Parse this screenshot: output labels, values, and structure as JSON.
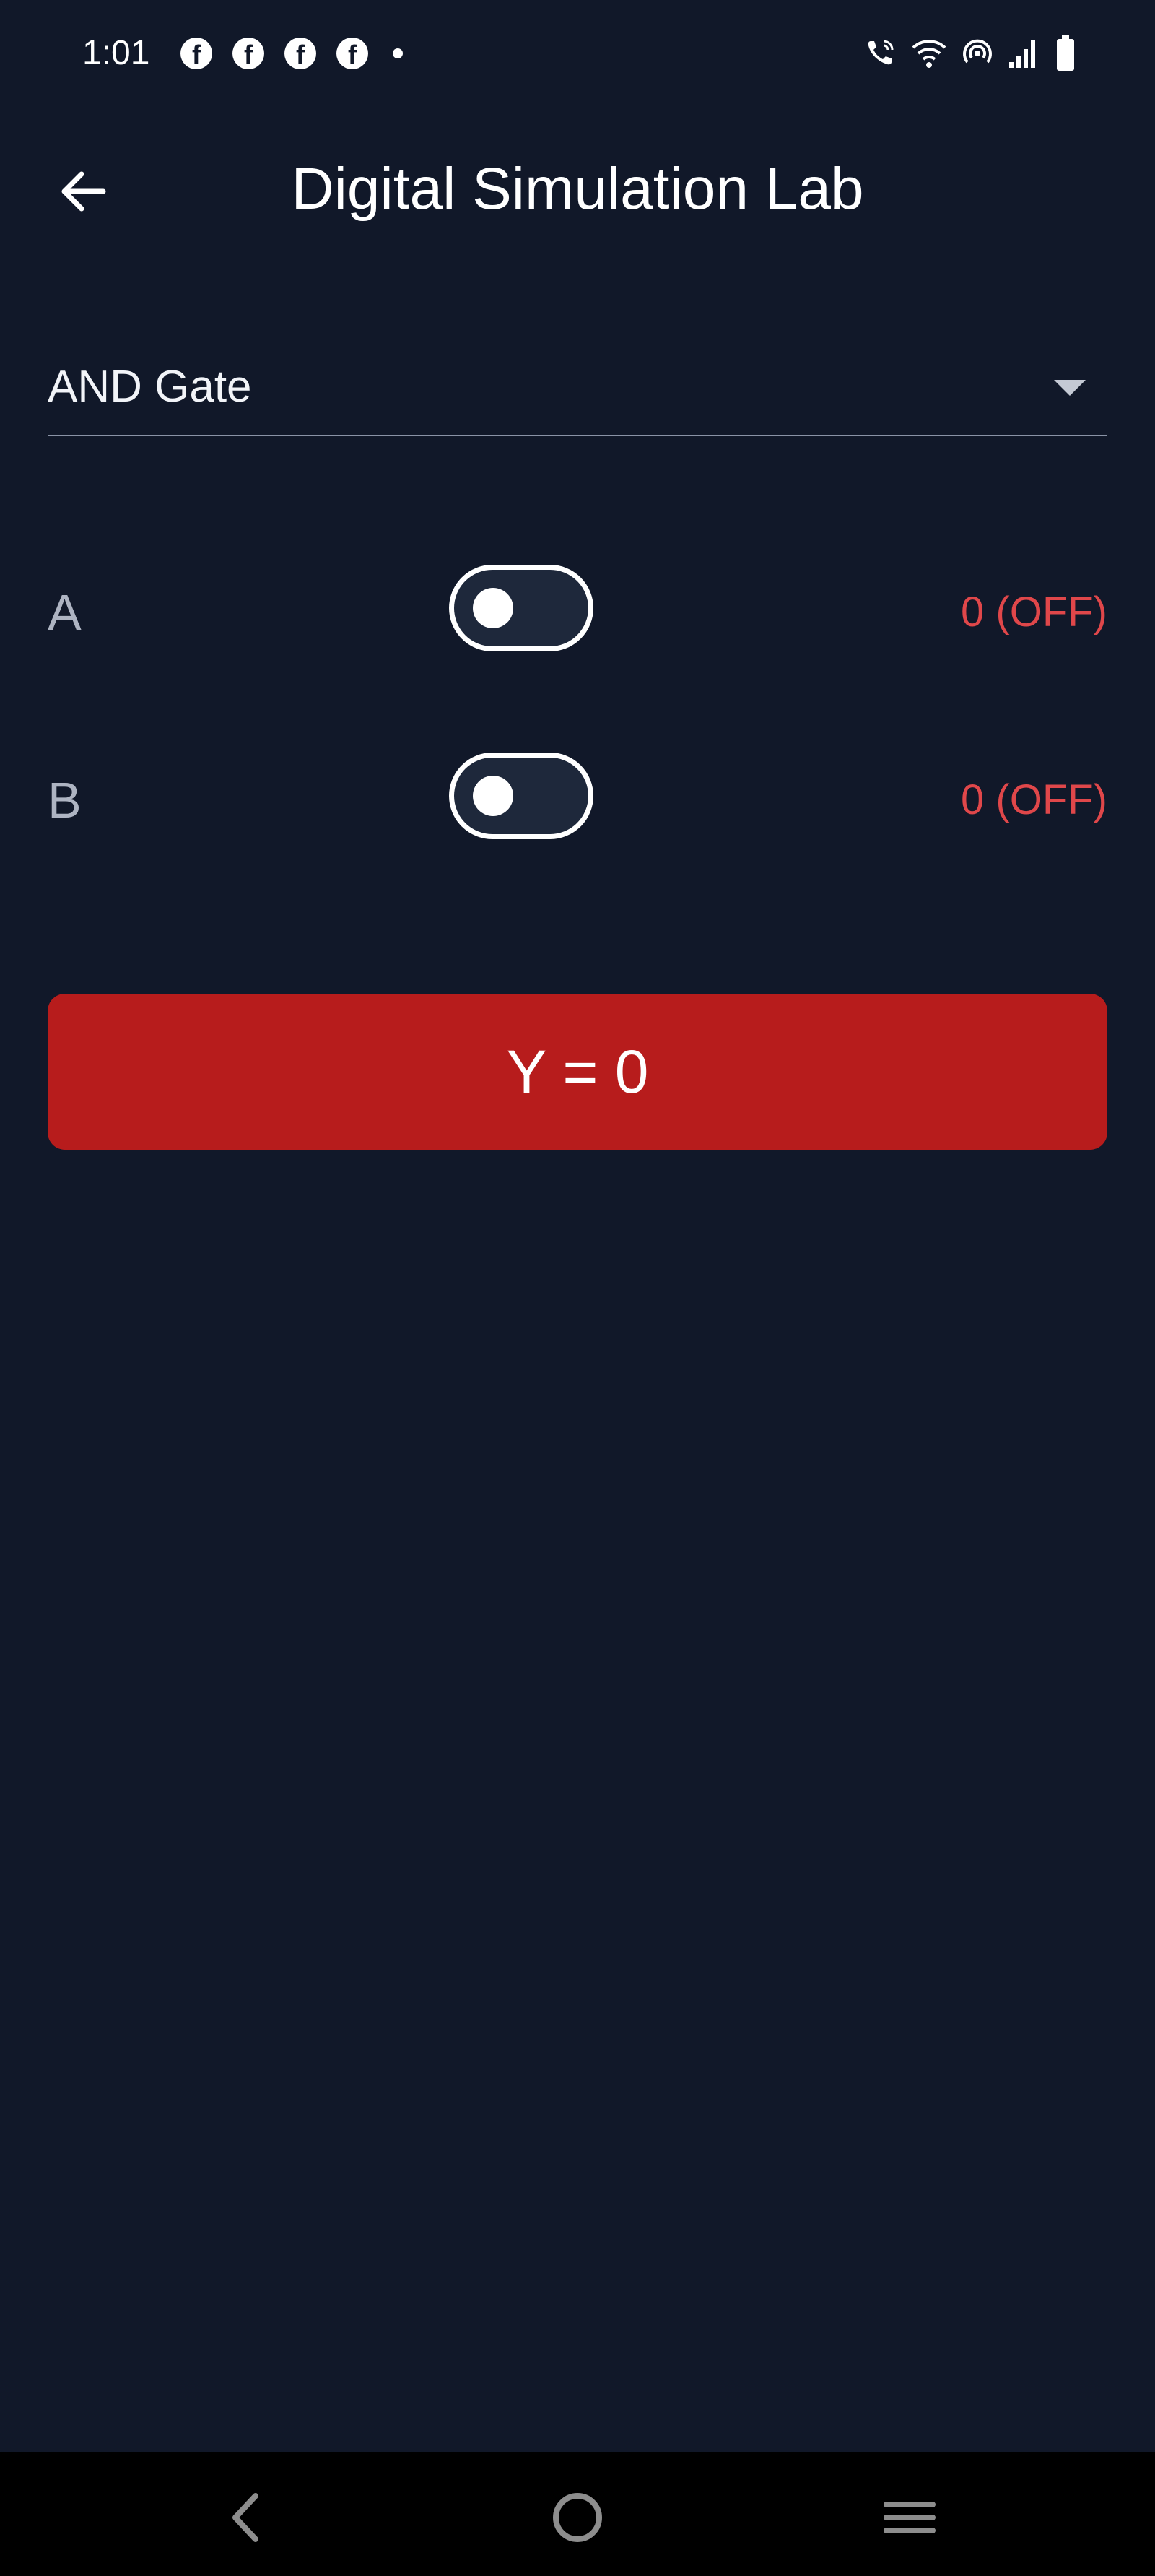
{
  "status_bar": {
    "time": "1:01",
    "left_icons": [
      "facebook-icon",
      "facebook-icon",
      "facebook-icon",
      "facebook-icon",
      "dot-icon"
    ],
    "right_icons": [
      "wifi-calling-icon",
      "wifi-icon",
      "hotspot-icon",
      "signal-icon",
      "battery-icon"
    ]
  },
  "app_bar": {
    "title": "Digital Simulation Lab",
    "back_icon": "arrow-left-icon"
  },
  "gate_select": {
    "selected": "AND Gate",
    "icon": "dropdown-arrow-icon"
  },
  "inputs": [
    {
      "label": "A",
      "on": false,
      "state_text": "0 (OFF)"
    },
    {
      "label": "B",
      "on": false,
      "state_text": "0 (OFF)"
    }
  ],
  "output": {
    "text": "Y = 0",
    "color": "#b71c1c"
  },
  "colors": {
    "background": "#111829",
    "off_state": "#e0474a",
    "output_low": "#b71c1c"
  },
  "nav_bar": {
    "icons": [
      "nav-back-icon",
      "nav-home-icon",
      "nav-recents-icon"
    ]
  }
}
